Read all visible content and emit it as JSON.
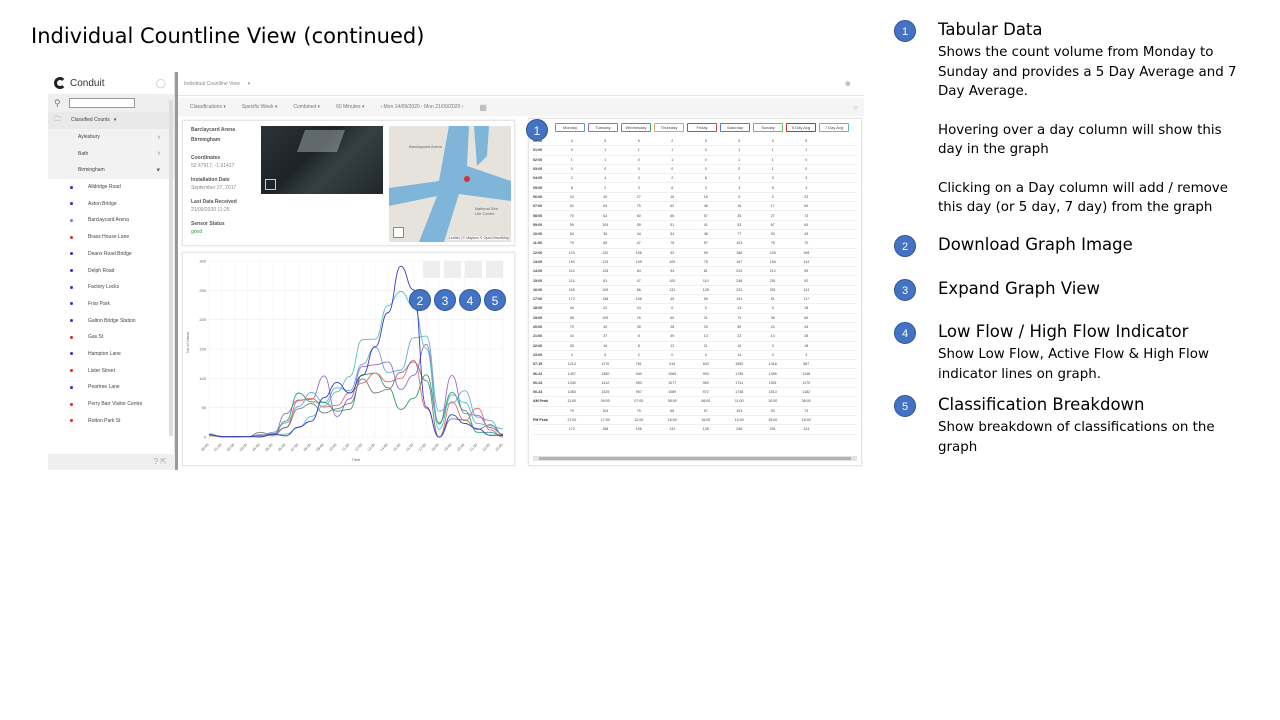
{
  "slide_title": "Individual Countline View (continued)",
  "sidebar": {
    "app_name": "Conduit",
    "category": "Classified Counts",
    "groups": [
      "Aylesbury",
      "Bath",
      "Birmingham"
    ],
    "sites": [
      {
        "label": "Alldridge Road",
        "color": "#2a35c4"
      },
      {
        "label": "Aston Bridge",
        "color": "#2a35c4"
      },
      {
        "label": "Barclaycard Arena",
        "color": "#9a6ad0"
      },
      {
        "label": "Brass House Lane",
        "color": "#d62a2a"
      },
      {
        "label": "Deans Road Bridge",
        "color": "#2a35c4"
      },
      {
        "label": "Delph Road",
        "color": "#2a35c4"
      },
      {
        "label": "Factory Locks",
        "color": "#2a35c4"
      },
      {
        "label": "Friar Park",
        "color": "#2a35c4"
      },
      {
        "label": "Galton Bridge Station",
        "color": "#2a35c4"
      },
      {
        "label": "Gas St",
        "color": "#d62a2a"
      },
      {
        "label": "Hampton Lane",
        "color": "#2a35c4"
      },
      {
        "label": "Lister Street",
        "color": "#d62a2a"
      },
      {
        "label": "Peartree Lane",
        "color": "#2a35c4"
      },
      {
        "label": "Perry Barr Visitor Centre",
        "color": "#d62a2a"
      },
      {
        "label": "Rotton Park St",
        "color": "#d62a2a"
      }
    ]
  },
  "topbar": {
    "view_name": "Individual Countline View"
  },
  "toolbar": {
    "classifications": "Classifications",
    "period": "Specific Week",
    "combined": "Combined",
    "interval": "60 Minutes",
    "date_range": "Mon 14/09/2020 - Mon 21/09/2020"
  },
  "info": {
    "site_line1": "Barclaycard Arena",
    "site_line2": "Birmingham",
    "coords_label": "Coordinates",
    "coords_value": "52.47917, -1.91417",
    "install_label": "Installation Date",
    "install_value": "September 27, 2017",
    "last_label": "Last Data Received",
    "last_value": "21/09/2020 11:25",
    "status_label": "Sensor Status",
    "status_value": "good",
    "map_label1": "Barclaycard Arena",
    "map_label2": "National Sea Life Centre",
    "map_attribution": "Leaflet | © Mapbox © OpenStreetMap"
  },
  "graph": {
    "y_label": "No of Users",
    "x_label": "Time",
    "y_ticks": [
      "300",
      "250",
      "200",
      "150",
      "100",
      "50",
      "0"
    ],
    "x_ticks": [
      "00:00",
      "01:00",
      "02:00",
      "03:00",
      "04:00",
      "05:00",
      "06:00",
      "07:00",
      "08:00",
      "09:00",
      "10:00",
      "11:00",
      "12:00",
      "13:00",
      "14:00",
      "15:00",
      "16:00",
      "17:00",
      "18:00",
      "19:00",
      "20:00",
      "21:00",
      "22:00",
      "23:00"
    ],
    "colors": [
      "#6aa9d8",
      "#9a6ad0",
      "#2ea06a",
      "#e07070",
      "#7a7a7a",
      "#56c0c0",
      "#3a3ac0"
    ]
  },
  "table": {
    "days": [
      {
        "label": "Monday",
        "color": "#5b9bd5"
      },
      {
        "label": "Tuesday",
        "color": "#9a6ad0"
      },
      {
        "label": "Wednesday",
        "color": "#3aa38a"
      },
      {
        "label": "Thursday",
        "color": "#e8a060"
      },
      {
        "label": "Friday",
        "color": "#d64040"
      },
      {
        "label": "Saturday",
        "color": "#4f7fc0"
      },
      {
        "label": "Sunday",
        "color": "#66bb6a"
      },
      {
        "label": "5 Day Avg",
        "color": "#d62a2a"
      },
      {
        "label": "7 Day Avg",
        "color": "#56c0c0"
      }
    ],
    "rows": [
      [
        "00:00",
        "4",
        "5",
        "5",
        "2",
        "5",
        "5",
        "4",
        "5"
      ],
      [
        "01:00",
        "0",
        "1",
        "1",
        "1",
        "0",
        "1",
        "1",
        "1"
      ],
      [
        "02:00",
        "1",
        "1",
        "0",
        "1",
        "0",
        "1",
        "1",
        "0"
      ],
      [
        "03:00",
        "0",
        "0",
        "0",
        "0",
        "0",
        "0",
        "1",
        "0"
      ],
      [
        "04:00",
        "2",
        "4",
        "3",
        "2",
        "8",
        "1",
        "0",
        "3"
      ],
      [
        "05:00",
        "8",
        "2",
        "3",
        "6",
        "3",
        "3",
        "5",
        "4"
      ],
      [
        "06:00",
        "24",
        "40",
        "27",
        "16",
        "16",
        "5",
        "2",
        "23"
      ],
      [
        "07:00",
        "52",
        "63",
        "75",
        "62",
        "48",
        "16",
        "17",
        "60"
      ],
      [
        "08:00",
        "76",
        "64",
        "60",
        "66",
        "57",
        "35",
        "27",
        "73"
      ],
      [
        "09:00",
        "59",
        "104",
        "59",
        "51",
        "41",
        "53",
        "67",
        "64"
      ],
      [
        "10:00",
        "84",
        "35",
        "44",
        "54",
        "48",
        "77",
        "93",
        "49"
      ],
      [
        "11:00",
        "79",
        "65",
        "47",
        "75",
        "57",
        "103",
        "75",
        "70"
      ],
      [
        "12:00",
        "124",
        "120",
        "106",
        "92",
        "99",
        "166",
        "105",
        "108"
      ],
      [
        "13:00",
        "153",
        "123",
        "109",
        "109",
        "75",
        "167",
        "154",
        "114"
      ],
      [
        "14:00",
        "110",
        "128",
        "84",
        "94",
        "81",
        "224",
        "212",
        "99"
      ],
      [
        "15:00",
        "114",
        "81",
        "47",
        "100",
        "110",
        "248",
        "291",
        "92"
      ],
      [
        "16:00",
        "169",
        "105",
        "66",
        "131",
        "128",
        "223",
        "251",
        "124"
      ],
      [
        "17:00",
        "172",
        "158",
        "106",
        "49",
        "96",
        "151",
        "51",
        "117"
      ],
      [
        "18:00",
        "44",
        "22",
        "24",
        "0",
        "0",
        "13",
        "0",
        "18"
      ],
      [
        "19:00",
        "58",
        "105",
        "76",
        "60",
        "31",
        "72",
        "38",
        "66"
      ],
      [
        "20:00",
        "79",
        "40",
        "45",
        "28",
        "29",
        "59",
        "23",
        "44"
      ],
      [
        "21:00",
        "34",
        "37",
        "8",
        "49",
        "13",
        "23",
        "14",
        "28"
      ],
      [
        "22:00",
        "28",
        "16",
        "8",
        "12",
        "21",
        "19",
        "3",
        "18"
      ],
      [
        "23:00",
        "3",
        "5",
        "2",
        "0",
        "4",
        "14",
        "3",
        "3"
      ],
      [
        "07-19",
        "1214",
        "1170",
        "761",
        "915",
        "843",
        "1552",
        "1416",
        "987"
      ],
      [
        "06-22",
        "1407",
        "1360",
        "940",
        "1065",
        "903",
        "1759",
        "1495",
        "1148"
      ],
      [
        "00-24",
        "1440",
        "1412",
        "953",
        "1077",
        "960",
        "1741",
        "1501",
        "1170"
      ],
      [
        "00-24",
        "1454",
        "1425",
        "957",
        "1089",
        "972",
        "1748",
        "1513",
        "1182"
      ],
      [
        "AM Peak",
        "11:00",
        "09:00",
        "07:00",
        "08:00",
        "08:00",
        "11:00",
        "10:00",
        "08:00"
      ],
      [
        "",
        "79",
        "104",
        "75",
        "66",
        "57",
        "103",
        "93",
        "73"
      ],
      [
        "PM Peak",
        "17:00",
        "17:00",
        "12:00",
        "16:00",
        "16:00",
        "15:00",
        "15:00",
        "16:00"
      ],
      [
        "",
        "172",
        "158",
        "106",
        "131",
        "128",
        "248",
        "291",
        "124"
      ]
    ]
  },
  "notes": [
    {
      "num": "1",
      "title": "Tabular Data",
      "body": [
        "Shows the count volume from Monday to Sunday and provides a 5 Day Average and 7 Day Average.",
        "Hovering over a day column will show this day in the graph",
        "Clicking on a Day column will add / remove this day (or 5 day, 7 day) from the graph"
      ]
    },
    {
      "num": "2",
      "title": "Download Graph Image",
      "body": []
    },
    {
      "num": "3",
      "title": "Expand Graph View",
      "body": []
    },
    {
      "num": "4",
      "title": "Low Flow / High Flow Indicator",
      "body": [
        "Show Low Flow, Active Flow & High Flow indicator lines on graph."
      ]
    },
    {
      "num": "5",
      "title": "Classification Breakdown",
      "body": [
        "Show breakdown of classifications on the graph"
      ]
    }
  ]
}
